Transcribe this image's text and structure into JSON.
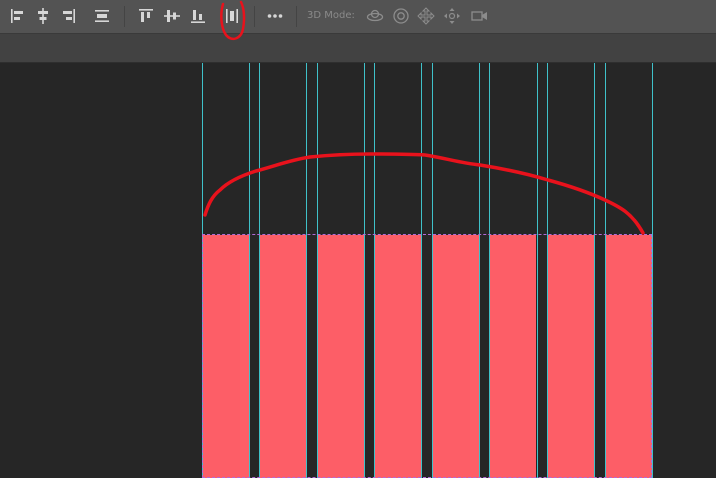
{
  "toolbar": {
    "mode_label": "3D Mode:",
    "icons": {
      "align_left": "align-left-edges-icon",
      "align_hcenter": "align-horizontal-centers-icon",
      "align_right": "align-right-edges-icon",
      "distribute_vcenter": "distribute-vertical-centers-icon",
      "align_top": "align-top-edges-icon",
      "align_vcenter": "align-vertical-centers-icon",
      "align_bottom": "align-bottom-edges-icon",
      "distribute_hspacing": "distribute-horizontal-spacing-icon",
      "more": "more-options-icon",
      "orbit": "orbit-3d-camera-icon",
      "roll": "roll-3d-camera-icon",
      "pan": "pan-3d-camera-icon",
      "slide": "slide-3d-camera-icon",
      "zoom": "zoom-3d-camera-icon"
    }
  },
  "canvas": {
    "column_count": 8,
    "guide_count": 16
  },
  "colors": {
    "toolbar_bg": "#535353",
    "canvas_bg": "#262626",
    "guide": "#3fc1c9",
    "column_fill": "#fd5e67",
    "selection": "#b06bd8",
    "annotation": "#e8121c"
  }
}
